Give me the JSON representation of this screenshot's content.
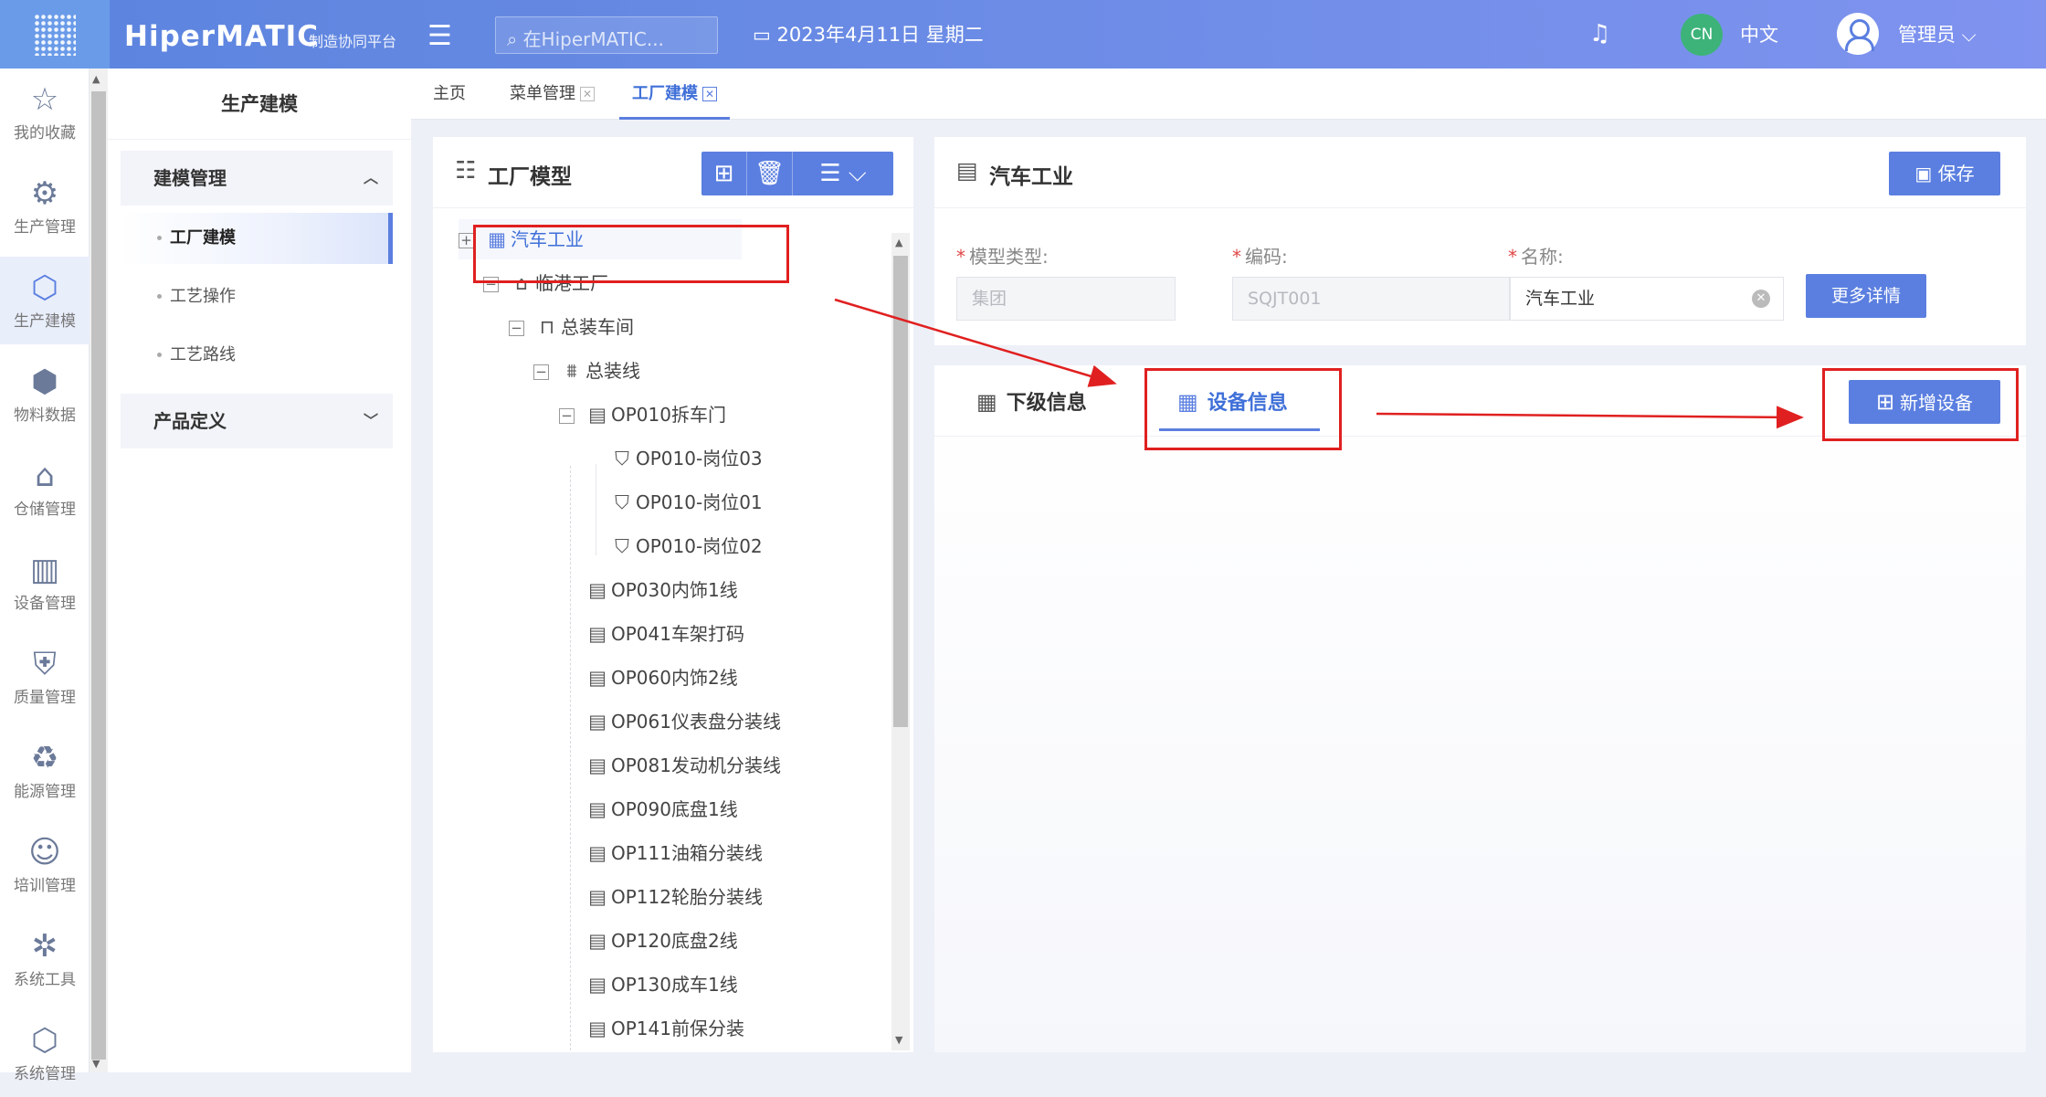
{
  "topbar": {
    "brand": "HiperMATIC",
    "brand_sub": "制造协同平台",
    "search_placeholder": "在HiperMATIC...",
    "date": "2023年4月11日 星期二",
    "lang_badge": "CN",
    "lang": "中文",
    "user": "管理员"
  },
  "leftnav": [
    {
      "label": "我的收藏",
      "icon": "star-icon"
    },
    {
      "label": "生产管理",
      "icon": "production-icon"
    },
    {
      "label": "生产建模",
      "icon": "cube-icon"
    },
    {
      "label": "物料数据",
      "icon": "box-icon"
    },
    {
      "label": "仓储管理",
      "icon": "warehouse-icon"
    },
    {
      "label": "设备管理",
      "icon": "equipment-icon"
    },
    {
      "label": "质量管理",
      "icon": "shield-icon"
    },
    {
      "label": "能源管理",
      "icon": "recycle-icon"
    },
    {
      "label": "培训管理",
      "icon": "training-icon"
    },
    {
      "label": "系统工具",
      "icon": "network-icon"
    },
    {
      "label": "系统管理",
      "icon": "settings-cube-icon"
    }
  ],
  "submenu": {
    "title": "生产建模",
    "group1": "建模管理",
    "items": [
      "工厂建模",
      "工艺操作",
      "工艺路线"
    ],
    "group2": "产品定义"
  },
  "tabs": [
    {
      "label": "主页"
    },
    {
      "label": "菜单管理"
    },
    {
      "label": "工厂建模"
    }
  ],
  "tree": {
    "title": "工厂模型",
    "nodes": [
      {
        "label": "汽车工业",
        "icon": "building-icon",
        "toggle": "⊞"
      },
      {
        "label": "临港工厂",
        "icon": "factory-icon",
        "toggle": "−"
      },
      {
        "label": "总装车间",
        "icon": "workshop-icon",
        "toggle": "−"
      },
      {
        "label": "总装线",
        "icon": "line-icon",
        "toggle": "−"
      },
      {
        "label": "OP010拆车门",
        "icon": "station-icon",
        "toggle": "−"
      },
      {
        "label": "OP010-岗位03",
        "icon": "post-icon"
      },
      {
        "label": "OP010-岗位01",
        "icon": "post-icon"
      },
      {
        "label": "OP010-岗位02",
        "icon": "post-icon"
      },
      {
        "label": "OP030内饰1线",
        "icon": "station-icon"
      },
      {
        "label": "OP041车架打码",
        "icon": "station-icon"
      },
      {
        "label": "OP060内饰2线",
        "icon": "station-icon"
      },
      {
        "label": "OP061仪表盘分装线",
        "icon": "station-icon"
      },
      {
        "label": "OP081发动机分装线",
        "icon": "station-icon"
      },
      {
        "label": "OP090底盘1线",
        "icon": "station-icon"
      },
      {
        "label": "OP111油箱分装线",
        "icon": "station-icon"
      },
      {
        "label": "OP112轮胎分装线",
        "icon": "station-icon"
      },
      {
        "label": "OP120底盘2线",
        "icon": "station-icon"
      },
      {
        "label": "OP130成车1线",
        "icon": "station-icon"
      },
      {
        "label": "OP141前保分装",
        "icon": "station-icon"
      }
    ]
  },
  "form": {
    "title": "汽车工业",
    "save": "保存",
    "type_label": "模型类型:",
    "type_value": "集团",
    "code_label": "编码:",
    "code_value": "SQJT001",
    "name_label": "名称:",
    "name_value": "汽车工业",
    "more": "更多详情",
    "required_mark": "*"
  },
  "detail": {
    "tab1": "下级信息",
    "tab2": "设备信息",
    "add": "新增设备"
  },
  "colors": {
    "primary": "#5b7fe0",
    "highlight": "#e02020"
  }
}
